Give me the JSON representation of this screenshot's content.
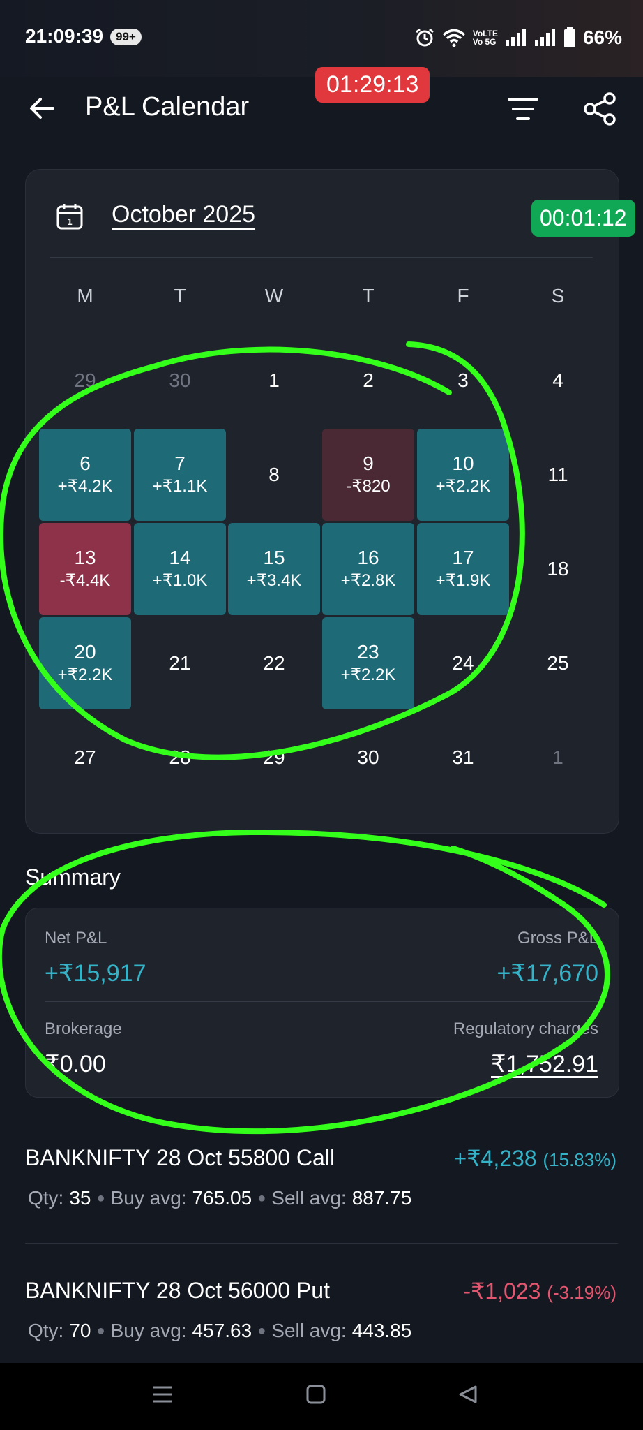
{
  "status_bar": {
    "time": "21:09:39",
    "badge": "99+",
    "volte_line1": "VoLTE",
    "volte_line2": "Vo 5G",
    "battery": "66%"
  },
  "header": {
    "title": "P&L Calendar",
    "recording_timer": "01:29:13"
  },
  "calendar": {
    "month_label": "October 2025",
    "overlay_timer": "00:01:12",
    "weekdays": [
      "M",
      "T",
      "W",
      "T",
      "F",
      "S"
    ],
    "days": [
      {
        "day": "29",
        "pnl": "",
        "style": "muted"
      },
      {
        "day": "30",
        "pnl": "",
        "style": "muted"
      },
      {
        "day": "1",
        "pnl": "",
        "style": "plain"
      },
      {
        "day": "2",
        "pnl": "",
        "style": "plain"
      },
      {
        "day": "3",
        "pnl": "",
        "style": "plain"
      },
      {
        "day": "4",
        "pnl": "",
        "style": "plain"
      },
      {
        "day": "6",
        "pnl": "+₹4.2K",
        "style": "profit"
      },
      {
        "day": "7",
        "pnl": "+₹1.1K",
        "style": "profit"
      },
      {
        "day": "8",
        "pnl": "",
        "style": "plain"
      },
      {
        "day": "9",
        "pnl": "-₹820",
        "style": "loss_small"
      },
      {
        "day": "10",
        "pnl": "+₹2.2K",
        "style": "profit"
      },
      {
        "day": "11",
        "pnl": "",
        "style": "plain"
      },
      {
        "day": "13",
        "pnl": "-₹4.4K",
        "style": "loss_large"
      },
      {
        "day": "14",
        "pnl": "+₹1.0K",
        "style": "profit"
      },
      {
        "day": "15",
        "pnl": "+₹3.4K",
        "style": "profit"
      },
      {
        "day": "16",
        "pnl": "+₹2.8K",
        "style": "profit"
      },
      {
        "day": "17",
        "pnl": "+₹1.9K",
        "style": "profit"
      },
      {
        "day": "18",
        "pnl": "",
        "style": "plain"
      },
      {
        "day": "20",
        "pnl": "+₹2.2K",
        "style": "profit"
      },
      {
        "day": "21",
        "pnl": "",
        "style": "plain"
      },
      {
        "day": "22",
        "pnl": "",
        "style": "plain"
      },
      {
        "day": "23",
        "pnl": "+₹2.2K",
        "style": "profit"
      },
      {
        "day": "24",
        "pnl": "",
        "style": "plain"
      },
      {
        "day": "25",
        "pnl": "",
        "style": "plain"
      },
      {
        "day": "27",
        "pnl": "",
        "style": "plain"
      },
      {
        "day": "28",
        "pnl": "",
        "style": "plain"
      },
      {
        "day": "29",
        "pnl": "",
        "style": "plain"
      },
      {
        "day": "30",
        "pnl": "",
        "style": "plain"
      },
      {
        "day": "31",
        "pnl": "",
        "style": "plain"
      },
      {
        "day": "1",
        "pnl": "",
        "style": "muted"
      }
    ]
  },
  "summary": {
    "title": "Summary",
    "net_label": "Net P&L",
    "net_value": "+₹15,917",
    "gross_label": "Gross P&L",
    "gross_value": "+₹17,670",
    "brokerage_label": "Brokerage",
    "brokerage_value": "₹0.00",
    "reg_label": "Regulatory charges",
    "reg_value": "₹1,752.91"
  },
  "positions": [
    {
      "name": "BANKNIFTY 28 Oct 55800 Call",
      "pnl": "+₹4,238",
      "pct": "(15.83%)",
      "qty_label": "Qty:",
      "qty": "35",
      "buy_label": "Buy avg:",
      "buy": "765.05",
      "sell_label": "Sell avg:",
      "sell": "887.75"
    },
    {
      "name": "BANKNIFTY 28 Oct 56000 Put",
      "pnl": "-₹1,023",
      "pct": "(-3.19%)",
      "qty_label": "Qty:",
      "qty": "70",
      "buy_label": "Buy avg:",
      "buy": "457.63",
      "sell_label": "Sell avg:",
      "sell": "443.85"
    }
  ],
  "colors": {
    "profit": "#1f6a77",
    "loss_small": "#4a2834",
    "loss_large": "#8d3248",
    "teal_text": "#34b3c8",
    "red_text": "#e2566f",
    "annotation": "#33ff1a"
  }
}
